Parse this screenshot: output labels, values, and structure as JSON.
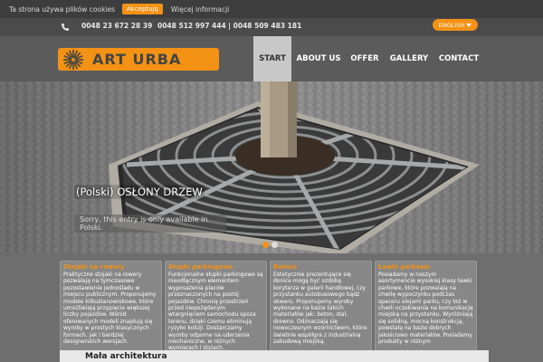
{
  "cookie": {
    "text": "Ta strona używa plików cookies",
    "accept_label": "Akceptuję",
    "more_label": "Więcej informacji"
  },
  "contact": {
    "phone1": "0048 23 672 28 39",
    "phone2": "0048 512 997 444 | 0048 509 483 181",
    "language": "ENGLISH"
  },
  "brand": {
    "name": "ART URBA",
    "accent": "#f39214"
  },
  "nav": {
    "items": [
      {
        "label": "START",
        "active": true
      },
      {
        "label": "ABOUT US",
        "active": false
      },
      {
        "label": "OFFER",
        "active": false
      },
      {
        "label": "GALLERY",
        "active": false
      },
      {
        "label": "CONTACT",
        "active": false
      }
    ]
  },
  "slider": {
    "title": "(Polski) OSŁONY DRZEW",
    "subtitle": "Sorry, this entry is only available in Polski.",
    "active_dot": 0,
    "dot_count": 2
  },
  "features": [
    {
      "title": "Stojaki na rowery",
      "body": "Praktyczne stojaki na rowery pozwalają na tymczasowe pozostawienie jednośladu w miejscu publicznym. Proponujemy modele kilkustanowiskowe, które umożliwiają przypięcie większej liczby pojazdów. Wśród oferowanych modeli znajdują się wyroby w prostych klasycznych formach, jak i bardziej designerskich wersjach."
    },
    {
      "title": "Słupki parkingowe",
      "body": "Funkcjonalne słupki parkingowe są nieodłącznym elementem wyposażenia placów przeznaczonych na postój pojazdów. Chronią przestrzeń przed niepożądanym wtargnięciem samochodu spoza terenu, dzięki czemu eliminują ryzyko kolizji. Dostarczamy wyroby odporne na uderzenia mechaniczne, w różnych wymiarach i stylach."
    },
    {
      "title": "Donice",
      "body": "Estetycznie prezentujące się donice mogą być ozdobą korytarza w galerii handlowej, czy przystanku autobusowego bądź skweru. Proponujemy wyroby wykonane na bazie takich materiałów jak: beton, stal, drewno. Odznaczają się nowoczesnym wzornictwem, które świetnie współgra z industrialną zabudową miejską."
    },
    {
      "title": "Ławki parkowe",
      "body": "Posiadamy w naszym asortymencie wysokiej klasy ławki parkowe, które pozwalają na chwilę wypoczynku podczas spaceru alejami parku, czy też w chwili oczekiwania na komunikację miejską na przystanku. Wyróżniają się solidną, mocną konstrukcją, powstałą na bazie dobrych jakościowo materiałów. Posiadamy produkty w różnym"
    }
  ],
  "section": {
    "title": "Mała architektura"
  }
}
